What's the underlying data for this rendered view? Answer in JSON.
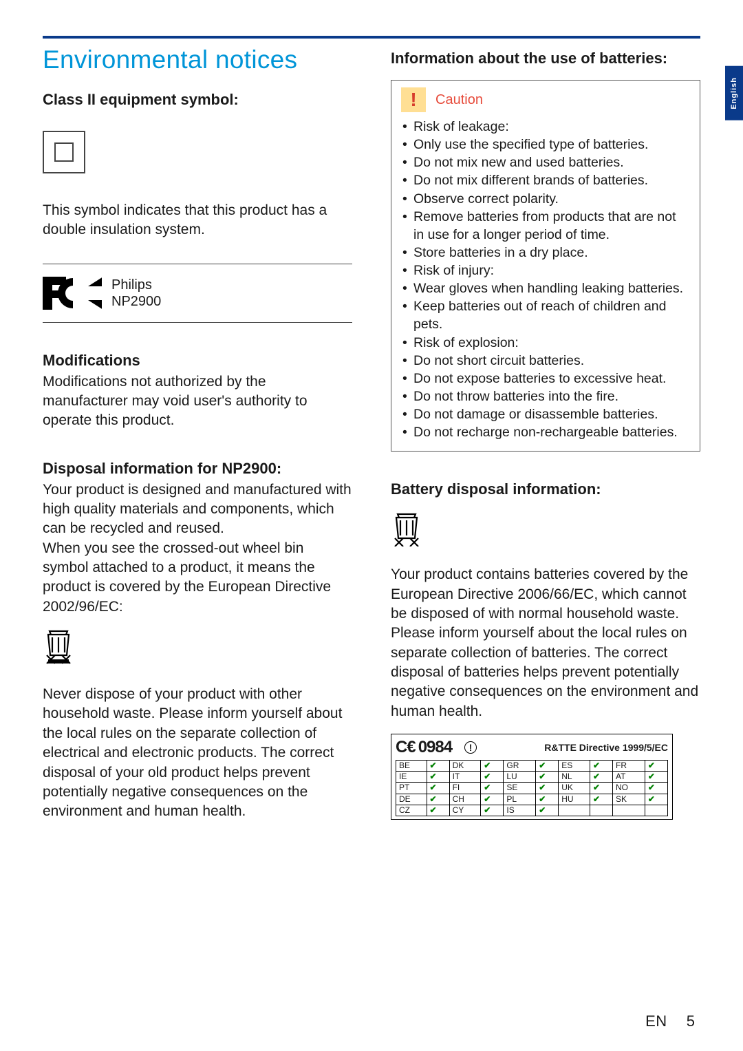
{
  "sidebar": {
    "language": "English"
  },
  "footer": {
    "lang_code": "EN",
    "page_number": "5"
  },
  "left": {
    "title": "Environmental notices",
    "class2_heading": "Class II equipment symbol:",
    "class2_desc": "This symbol indicates that this product has a double insulation system.",
    "fcc_brand": "Philips",
    "fcc_model": "NP2900",
    "modifications_heading": "Modifications",
    "modifications_body": "Modifications not authorized by the manufacturer may void user's authority to operate this product.",
    "disposal_heading": "Disposal information for NP2900:",
    "disposal_body1": "Your product is designed and manufactured with high quality materials and components, which can be recycled and reused.",
    "disposal_body2": "When you see the crossed-out wheel bin symbol attached to a product, it means the product is covered by the European Directive 2002/96/EC:",
    "disposal_body3": "Never dispose of your product with other household waste. Please inform yourself about the local rules on the separate collection of electrical and electronic products. The correct disposal of your old product helps prevent potentially negative consequences on the environment and human health."
  },
  "right": {
    "batteries_heading": "Information about the use of batteries:",
    "caution_label": "Caution",
    "caution_items": [
      "Risk of leakage:",
      "Only use the specified type of batteries.",
      "Do not mix new and used batteries.",
      "Do not mix different brands of batteries.",
      "Observe correct polarity.",
      "Remove batteries from products that are not in use for a longer period of time.",
      "Store batteries in a dry place.",
      "Risk of injury:",
      "Wear gloves when handling leaking batteries.",
      "Keep batteries out of reach of children and pets.",
      "Risk of explosion:",
      "Do not short circuit batteries.",
      "Do not expose batteries to excessive heat.",
      "Do not throw batteries into the fire.",
      "Do not damage or disassemble batteries.",
      "Do not recharge non-rechargeable batteries."
    ],
    "battery_disposal_heading": "Battery disposal information:",
    "battery_disposal_body1": "Your product contains batteries covered by the European Directive 2006/66/EC, which cannot be disposed of with normal household waste.",
    "battery_disposal_body2": "Please inform yourself about the local rules on separate collection of batteries. The correct disposal of batteries helps prevent potentially negative consequences on the environment and human health.",
    "ce_number": "0984",
    "ce_directive": "R&TTE Directive 1999/5/EC",
    "ce_countries": [
      [
        "BE",
        "DK",
        "GR",
        "ES",
        "FR"
      ],
      [
        "IE",
        "IT",
        "LU",
        "NL",
        "AT"
      ],
      [
        "PT",
        "FI",
        "SE",
        "UK",
        "NO"
      ],
      [
        "DE",
        "CH",
        "PL",
        "HU",
        "SK"
      ],
      [
        "CZ",
        "CY",
        "IS",
        "",
        ""
      ]
    ]
  }
}
